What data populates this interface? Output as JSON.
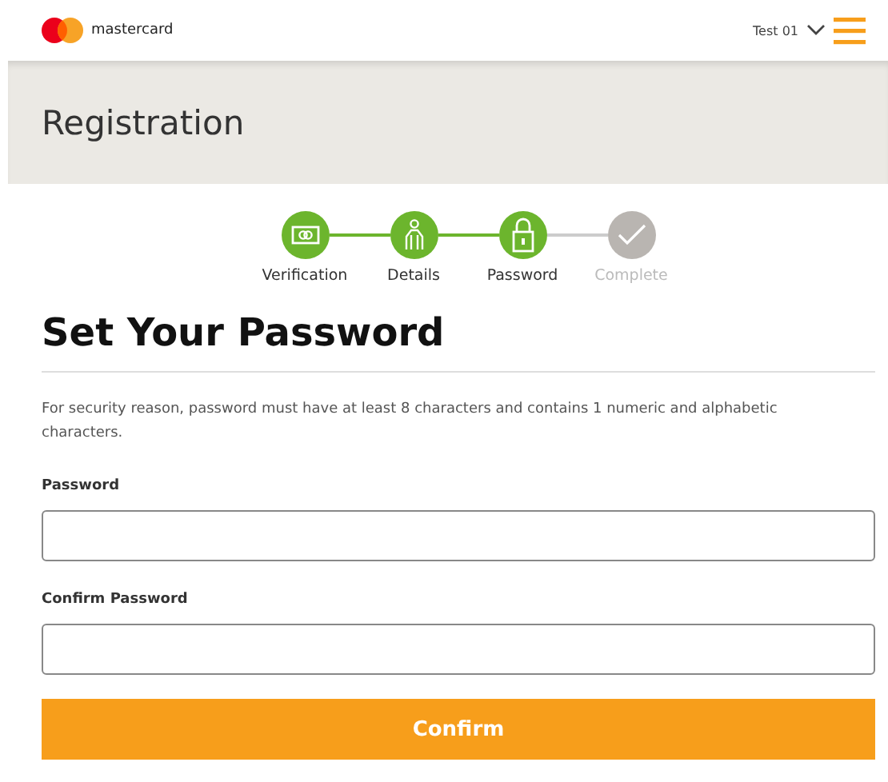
{
  "header": {
    "brand": "mastercard",
    "user": "Test 01"
  },
  "banner": {
    "title": "Registration"
  },
  "steps": [
    {
      "label": "Verification",
      "kind": "card",
      "completed": true
    },
    {
      "label": "Details",
      "kind": "person",
      "completed": true
    },
    {
      "label": "Password",
      "kind": "lock",
      "completed": true
    },
    {
      "label": "Complete",
      "kind": "check",
      "completed": false
    }
  ],
  "heading": "Set Your Password",
  "note": "For security reason, password must have at least 8 characters and contains 1 numeric and alphabetic characters.",
  "fields": [
    {
      "label": "Password"
    },
    {
      "label": "Confirm Password"
    }
  ],
  "button": "Confirm"
}
